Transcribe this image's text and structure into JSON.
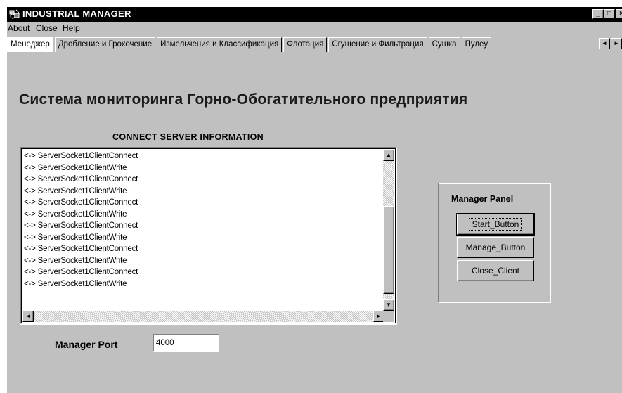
{
  "window": {
    "title": "INDUSTRIAL MANAGER",
    "icon": "app-gear-icon",
    "controls": {
      "minimize": "_",
      "maximize": "□",
      "close": "×"
    }
  },
  "menu": {
    "items": [
      {
        "accel": "A",
        "rest": "bout"
      },
      {
        "accel": "C",
        "rest": "lose"
      },
      {
        "accel": "H",
        "rest": "elp"
      }
    ]
  },
  "tabs": {
    "items": [
      "Менеджер",
      "Дробление и Грохочение",
      "Измельчения и Классификация",
      "Флотация",
      "Сгущение и Фильтрация",
      "Сушка",
      "Пулеу"
    ],
    "active": 0,
    "scroll_left": "◄",
    "scroll_right": "►"
  },
  "main": {
    "heading": "Система мониторинга Горно-Обогатительного предприятия",
    "log_title": "CONNECT SERVER INFORMATION",
    "log_lines": [
      "<-> ServerSocket1ClientConnect",
      "<-> ServerSocket1ClientWrite",
      "<-> ServerSocket1ClientConnect",
      "<-> ServerSocket1ClientWrite",
      "<-> ServerSocket1ClientConnect",
      "<-> ServerSocket1ClientWrite",
      "<-> ServerSocket1ClientConnect",
      "<-> ServerSocket1ClientWrite",
      "<-> ServerSocket1ClientConnect",
      "<-> ServerSocket1ClientWrite",
      "<-> ServerSocket1ClientConnect",
      "<-> ServerSocket1ClientWrite"
    ],
    "scroll": {
      "up": "▲",
      "down": "▼",
      "left": "◄",
      "right": "►"
    }
  },
  "panel": {
    "title": "Manager Panel",
    "start_label": "Start_Button",
    "manage_label": "Manage_Button",
    "close_label": "Close_Client"
  },
  "port": {
    "label": "Manager Port",
    "value": "4000"
  }
}
